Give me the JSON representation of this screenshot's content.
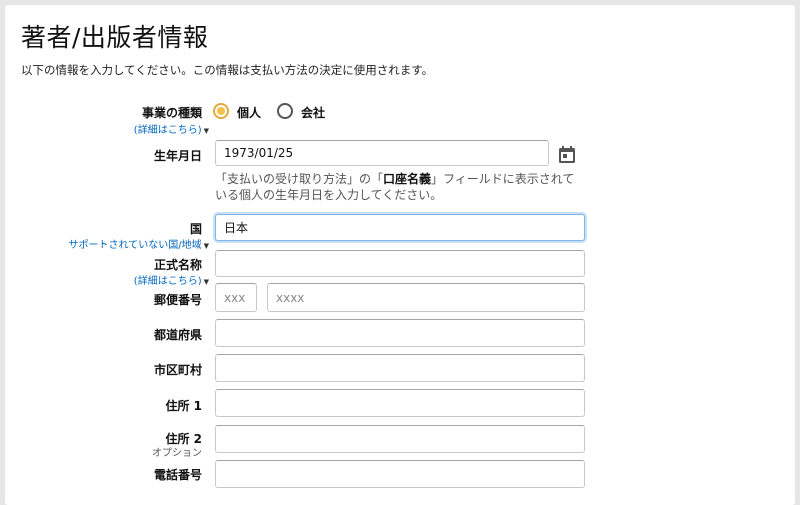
{
  "header": {
    "title": "著者/出版者情報",
    "subtitle": "以下の情報を入力してください。この情報は支払い方法の決定に使用されます。"
  },
  "business_type": {
    "label": "事業の種類",
    "help_link": "(詳細はこちら)",
    "options": [
      "個人",
      "会社"
    ],
    "selected": "個人"
  },
  "birth_date": {
    "label": "生年月日",
    "value": "1973/01/25",
    "hint_prefix": "「支払いの受け取り方法」の「",
    "hint_bold": "口座名義",
    "hint_suffix": "」フィールドに表示されている個人の生年月日を入力してください。"
  },
  "country": {
    "label": "国",
    "help_link": "サポートされていない国/地域",
    "value": "日本"
  },
  "legal_name": {
    "label": "正式名称",
    "help_link": "(詳細はこちら)",
    "value": ""
  },
  "postal_code": {
    "label": "郵便番号",
    "placeholder_1": "xxx",
    "placeholder_2": "xxxx"
  },
  "prefecture": {
    "label": "都道府県",
    "value": ""
  },
  "city": {
    "label": "市区町村",
    "value": ""
  },
  "address1": {
    "label": "住所 1",
    "value": ""
  },
  "address2": {
    "label": "住所 2",
    "optional": "オプション",
    "value": ""
  },
  "phone": {
    "label": "電話番号",
    "value": ""
  }
}
